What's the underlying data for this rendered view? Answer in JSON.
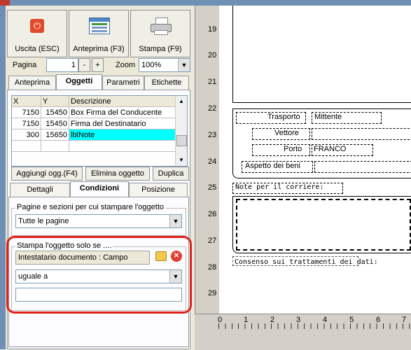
{
  "toolbar": {
    "exit_label": "Uscita (ESC)",
    "preview_label": "Anteprima (F3)",
    "print_label": "Stampa (F9)"
  },
  "page_nav": {
    "page_label": "Pagina",
    "page_value": "1",
    "minus": "-",
    "plus": "+",
    "zoom_label": "Zoom",
    "zoom_value": "100%"
  },
  "top_tabs": [
    "Anteprima",
    "Oggetti",
    "Parametri",
    "Etichette"
  ],
  "objects_table": {
    "headers": [
      "X",
      "Y",
      "Descrizione"
    ],
    "rows": [
      {
        "x": "7150",
        "y": "15450",
        "desc": "Box Firma del Conducente"
      },
      {
        "x": "7150",
        "y": "15450",
        "desc": "Firma del Destinatario"
      },
      {
        "x": "300",
        "y": "15650",
        "desc": "lblNote"
      }
    ]
  },
  "object_buttons": {
    "add": "Aggiungi ogg.(F4)",
    "delete": "Elimina oggetto",
    "duplicate": "Duplica"
  },
  "sub_tabs": [
    "Dettagli",
    "Condizioni",
    "Posizione"
  ],
  "conditions": {
    "sections_group_label": "Pagine e sezioni per cui stampare l'oggetto",
    "sections_value": "Tutte le pagine",
    "print_only_if_label": "Stampa l'oggetto solo se ....",
    "field_value": "Intestatario documento : Campo",
    "operator_value": "uguale a",
    "compare_value": ""
  },
  "ruler": {
    "vertical": [
      "19",
      "20",
      "21",
      "22",
      "23",
      "24",
      "25",
      "26",
      "27",
      "28",
      "29"
    ],
    "horizontal": [
      "0",
      "1",
      "2",
      "3",
      "4",
      "5",
      "6",
      "7"
    ]
  },
  "report": {
    "trasporto_label": "Trasporto",
    "trasporto_value": "Mittente",
    "vettore_label": "Vettore",
    "porto_label": "Porto",
    "porto_value": "FRANCO",
    "aspetto_label": "Aspetto dei beni",
    "note_label": "Note  per il corriere:",
    "consenso_label": "Consenso sui trattamenti dei dati:"
  },
  "colors": {
    "highlight_row": "#00ffff",
    "annotation_red": "#e0201a",
    "frame": "#6f8fb5"
  }
}
